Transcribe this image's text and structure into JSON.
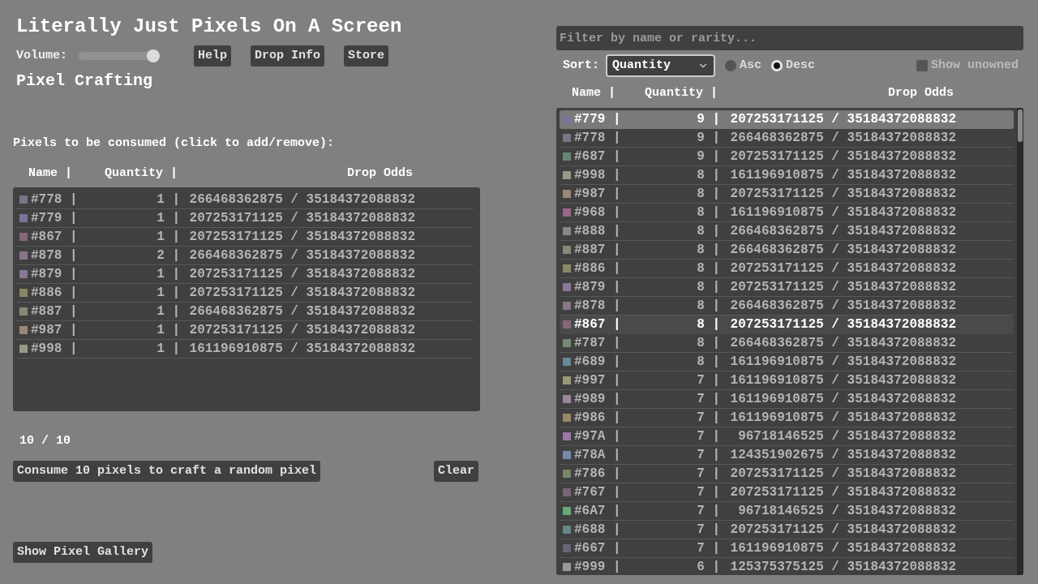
{
  "title": "Literally Just Pixels On A Screen",
  "volume": {
    "label": "Volume:",
    "level": 0.92
  },
  "top_buttons": [
    "Help",
    "Drop Info",
    "Store"
  ],
  "crafting": {
    "heading": "Pixel Crafting",
    "consume_label": "Pixels to be consumed (click to add/remove):",
    "columns": [
      "Name |",
      "Quantity |",
      "Drop Odds"
    ],
    "rows": [
      {
        "name": "#778 |",
        "quantity": "1 |",
        "odds": "266468362875 / 35184372088832",
        "color": "#777788"
      },
      {
        "name": "#779 |",
        "quantity": "1 |",
        "odds": "207253171125 / 35184372088832",
        "color": "#777799"
      },
      {
        "name": "#867 |",
        "quantity": "1 |",
        "odds": "207253171125 / 35184372088832",
        "color": "#886677"
      },
      {
        "name": "#878 |",
        "quantity": "2 |",
        "odds": "266468362875 / 35184372088832",
        "color": "#887788"
      },
      {
        "name": "#879 |",
        "quantity": "1 |",
        "odds": "207253171125 / 35184372088832",
        "color": "#887799"
      },
      {
        "name": "#886 |",
        "quantity": "1 |",
        "odds": "207253171125 / 35184372088832",
        "color": "#888866"
      },
      {
        "name": "#887 |",
        "quantity": "1 |",
        "odds": "266468362875 / 35184372088832",
        "color": "#888877"
      },
      {
        "name": "#987 |",
        "quantity": "1 |",
        "odds": "207253171125 / 35184372088832",
        "color": "#998877"
      },
      {
        "name": "#998 |",
        "quantity": "1 |",
        "odds": "161196910875 / 35184372088832",
        "color": "#999988"
      }
    ],
    "count": "10 / 10",
    "consume_button": "Consume 10 pixels to craft a random pixel",
    "clear_button": "Clear",
    "gallery_button": "Show Pixel Gallery"
  },
  "inventory": {
    "filter_placeholder": "Filter by name or rarity...",
    "sort_label": "Sort:",
    "sort_value": "Quantity",
    "order": [
      {
        "label": "Asc",
        "selected": false
      },
      {
        "label": "Desc",
        "selected": true
      }
    ],
    "show_unowned": {
      "label": "Show unowned",
      "checked": false
    },
    "columns": [
      "Name |",
      "Quantity |",
      "Drop Odds"
    ],
    "rows": [
      {
        "name": "#779 |",
        "quantity": "9 |",
        "odds": "207253171125 / 35184372088832",
        "color": "#777799",
        "selected": true,
        "hovered": false
      },
      {
        "name": "#778 |",
        "quantity": "9 |",
        "odds": "266468362875 / 35184372088832",
        "color": "#777788",
        "selected": false,
        "hovered": false
      },
      {
        "name": "#687 |",
        "quantity": "9 |",
        "odds": "207253171125 / 35184372088832",
        "color": "#668877",
        "selected": false,
        "hovered": false
      },
      {
        "name": "#998 |",
        "quantity": "8 |",
        "odds": "161196910875 / 35184372088832",
        "color": "#999988",
        "selected": false,
        "hovered": false
      },
      {
        "name": "#987 |",
        "quantity": "8 |",
        "odds": "207253171125 / 35184372088832",
        "color": "#998877",
        "selected": false,
        "hovered": false
      },
      {
        "name": "#968 |",
        "quantity": "8 |",
        "odds": "161196910875 / 35184372088832",
        "color": "#996688",
        "selected": false,
        "hovered": false
      },
      {
        "name": "#888 |",
        "quantity": "8 |",
        "odds": "266468362875 / 35184372088832",
        "color": "#888888",
        "selected": false,
        "hovered": false
      },
      {
        "name": "#887 |",
        "quantity": "8 |",
        "odds": "266468362875 / 35184372088832",
        "color": "#888877",
        "selected": false,
        "hovered": false
      },
      {
        "name": "#886 |",
        "quantity": "8 |",
        "odds": "207253171125 / 35184372088832",
        "color": "#888866",
        "selected": false,
        "hovered": false
      },
      {
        "name": "#879 |",
        "quantity": "8 |",
        "odds": "207253171125 / 35184372088832",
        "color": "#887799",
        "selected": false,
        "hovered": false
      },
      {
        "name": "#878 |",
        "quantity": "8 |",
        "odds": "266468362875 / 35184372088832",
        "color": "#887788",
        "selected": false,
        "hovered": false
      },
      {
        "name": "#867 |",
        "quantity": "8 |",
        "odds": "207253171125 / 35184372088832",
        "color": "#886677",
        "selected": false,
        "hovered": true
      },
      {
        "name": "#787 |",
        "quantity": "8 |",
        "odds": "266468362875 / 35184372088832",
        "color": "#778877",
        "selected": false,
        "hovered": false
      },
      {
        "name": "#689 |",
        "quantity": "8 |",
        "odds": "161196910875 / 35184372088832",
        "color": "#668899",
        "selected": false,
        "hovered": false
      },
      {
        "name": "#997 |",
        "quantity": "7 |",
        "odds": "161196910875 / 35184372088832",
        "color": "#999977",
        "selected": false,
        "hovered": false
      },
      {
        "name": "#989 |",
        "quantity": "7 |",
        "odds": "161196910875 / 35184372088832",
        "color": "#998899",
        "selected": false,
        "hovered": false
      },
      {
        "name": "#986 |",
        "quantity": "7 |",
        "odds": "161196910875 / 35184372088832",
        "color": "#998866",
        "selected": false,
        "hovered": false
      },
      {
        "name": "#97A |",
        "quantity": "7 |",
        "odds": "96718146525 / 35184372088832",
        "color": "#9977aa",
        "selected": false,
        "hovered": false
      },
      {
        "name": "#78A |",
        "quantity": "7 |",
        "odds": "124351902675 / 35184372088832",
        "color": "#7788aa",
        "selected": false,
        "hovered": false
      },
      {
        "name": "#786 |",
        "quantity": "7 |",
        "odds": "207253171125 / 35184372088832",
        "color": "#778866",
        "selected": false,
        "hovered": false
      },
      {
        "name": "#767 |",
        "quantity": "7 |",
        "odds": "207253171125 / 35184372088832",
        "color": "#776677",
        "selected": false,
        "hovered": false
      },
      {
        "name": "#6A7 |",
        "quantity": "7 |",
        "odds": "96718146525 / 35184372088832",
        "color": "#66aa77",
        "selected": false,
        "hovered": false
      },
      {
        "name": "#688 |",
        "quantity": "7 |",
        "odds": "207253171125 / 35184372088832",
        "color": "#668888",
        "selected": false,
        "hovered": false
      },
      {
        "name": "#667 |",
        "quantity": "7 |",
        "odds": "161196910875 / 35184372088832",
        "color": "#666677",
        "selected": false,
        "hovered": false
      },
      {
        "name": "#999 |",
        "quantity": "6 |",
        "odds": "125375375125 / 35184372088832",
        "color": "#999999",
        "selected": false,
        "hovered": false
      }
    ]
  }
}
